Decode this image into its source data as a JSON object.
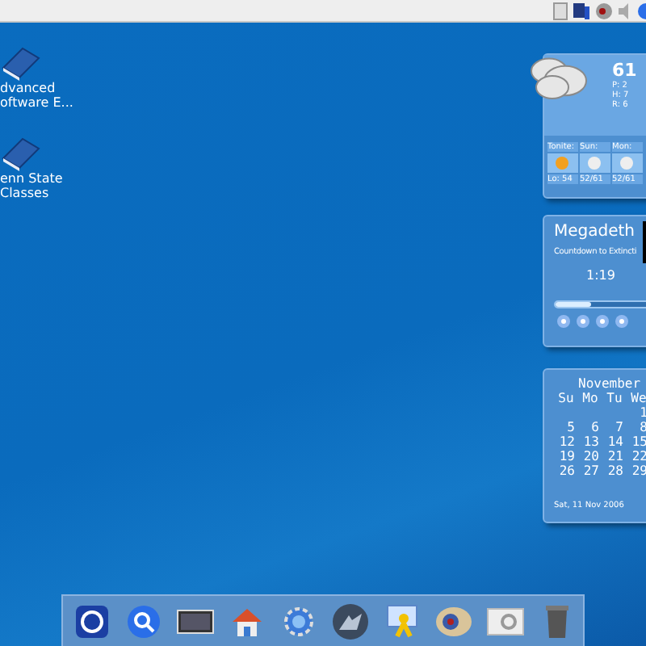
{
  "desktop_icons": [
    {
      "lines": [
        "dvanced",
        "oftware E..."
      ]
    },
    {
      "lines": [
        "enn State",
        "Classes"
      ]
    }
  ],
  "weather": {
    "temperature": "61",
    "details": [
      "P: 2",
      "H: 7",
      "R: 6"
    ],
    "forecast": [
      {
        "day": "Tonite:",
        "temps": "Lo: 54"
      },
      {
        "day": "Sun:",
        "temps": "52/61"
      },
      {
        "day": "Mon:",
        "temps": "52/61"
      }
    ]
  },
  "media_player": {
    "artist": "Megadeth",
    "track": "Countdown to Extincti",
    "time": "1:19",
    "level": 0.35
  },
  "calendar": {
    "month": "November",
    "weekdays": [
      "Su",
      "Mo",
      "Tu",
      "We"
    ],
    "weeks": [
      [
        "1"
      ],
      [
        "5",
        "6",
        "7",
        "8"
      ],
      [
        "12",
        "13",
        "14",
        "15"
      ],
      [
        "19",
        "20",
        "21",
        "22"
      ],
      [
        "26",
        "27",
        "28",
        "29"
      ]
    ],
    "date": "Sat, 11 Nov 2006"
  }
}
